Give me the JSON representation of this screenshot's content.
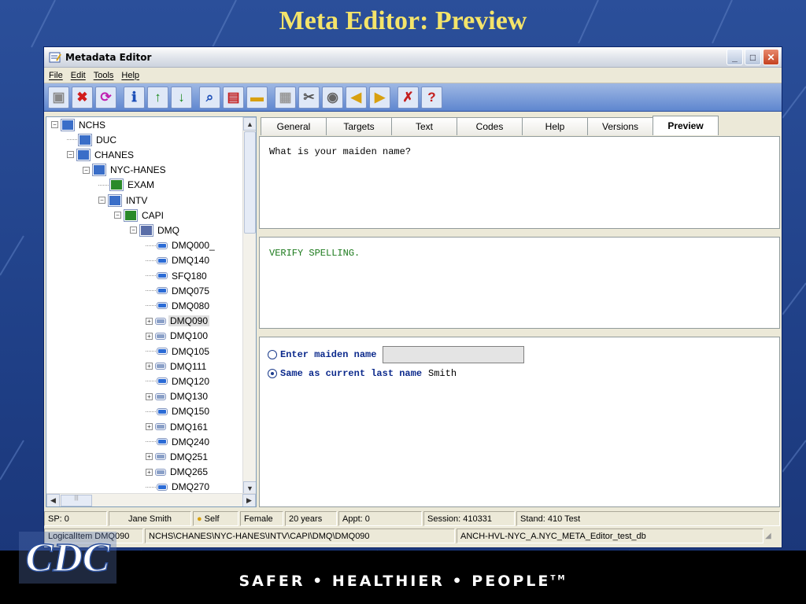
{
  "slide": {
    "title": "Meta Editor: Preview",
    "tagline": "SAFER • HEALTHIER • PEOPLE",
    "tm": "TM",
    "logo_text": "CDC"
  },
  "window": {
    "title": "Metadata Editor",
    "menu": [
      "File",
      "Edit",
      "Tools",
      "Help"
    ]
  },
  "toolbar": {
    "buttons": [
      {
        "name": "save-icon",
        "glyph": "▣",
        "color": "#8a8a8a"
      },
      {
        "name": "delete-icon",
        "glyph": "✖",
        "color": "#d11c1c"
      },
      {
        "name": "refresh-icon",
        "glyph": "⟳",
        "color": "#c020b0"
      },
      {
        "name": "info-icon",
        "glyph": "ℹ",
        "color": "#1d4fb8"
      },
      {
        "name": "move-up-icon",
        "glyph": "↑",
        "color": "#1b8a1b"
      },
      {
        "name": "move-down-icon",
        "glyph": "↓",
        "color": "#1b8a1b"
      },
      {
        "name": "search-icon",
        "glyph": "⌕",
        "color": "#1d4fb8"
      },
      {
        "name": "us-flag-icon",
        "glyph": "▤",
        "color": "#c41e1e"
      },
      {
        "name": "spain-flag-icon",
        "glyph": "▬",
        "color": "#d8a010"
      },
      {
        "name": "document-icon",
        "glyph": "▦",
        "color": "#9a9a9a"
      },
      {
        "name": "tools-icon",
        "glyph": "✂",
        "color": "#555555"
      },
      {
        "name": "audio-icon",
        "glyph": "◉",
        "color": "#666666"
      },
      {
        "name": "previous-icon",
        "glyph": "◀",
        "color": "#d8a010"
      },
      {
        "name": "next-icon",
        "glyph": "▶",
        "color": "#d8a010"
      },
      {
        "name": "clear-icon",
        "glyph": "✗",
        "color": "#c41e1e"
      },
      {
        "name": "help-icon",
        "glyph": "?",
        "color": "#c41e1e"
      }
    ]
  },
  "tree": {
    "nodes": [
      {
        "label": "NCHS",
        "icon": "group",
        "exp": "−"
      },
      {
        "label": "DUC",
        "icon": "group",
        "exp": ""
      },
      {
        "label": "CHANES",
        "icon": "group",
        "exp": "−"
      },
      {
        "label": "NYC-HANES",
        "icon": "group",
        "exp": "−"
      },
      {
        "label": "EXAM",
        "icon": "form",
        "exp": ""
      },
      {
        "label": "INTV",
        "icon": "group",
        "exp": "−"
      },
      {
        "label": "CAPI",
        "icon": "form",
        "exp": "−"
      },
      {
        "label": "DMQ",
        "icon": "section",
        "exp": "−"
      },
      {
        "label": "DMQ000_",
        "icon": "item-special",
        "exp": ""
      },
      {
        "label": "DMQ140",
        "icon": "item",
        "exp": ""
      },
      {
        "label": "SFQ180",
        "icon": "item",
        "exp": ""
      },
      {
        "label": "DMQ075",
        "icon": "item-check",
        "exp": ""
      },
      {
        "label": "DMQ080",
        "icon": "item",
        "exp": ""
      },
      {
        "label": "DMQ090",
        "icon": "item-group",
        "exp": "+"
      },
      {
        "label": "DMQ100",
        "icon": "item-group",
        "exp": "+"
      },
      {
        "label": "DMQ105",
        "icon": "item",
        "exp": ""
      },
      {
        "label": "DMQ111",
        "icon": "item-group",
        "exp": "+"
      },
      {
        "label": "DMQ120",
        "icon": "item-check",
        "exp": ""
      },
      {
        "label": "DMQ130",
        "icon": "item-group",
        "exp": "+"
      },
      {
        "label": "DMQ150",
        "icon": "item-check",
        "exp": ""
      },
      {
        "label": "DMQ161",
        "icon": "item-group",
        "exp": "+"
      },
      {
        "label": "DMQ240",
        "icon": "item",
        "exp": ""
      },
      {
        "label": "DMQ251",
        "icon": "item-group",
        "exp": "+"
      },
      {
        "label": "DMQ265",
        "icon": "item-group",
        "exp": "+"
      },
      {
        "label": "DMQ270",
        "icon": "item-check",
        "exp": ""
      }
    ],
    "selected": "DMQ090"
  },
  "tabs": [
    "General",
    "Targets",
    "Text",
    "Codes",
    "Help",
    "Versions",
    "Preview"
  ],
  "active_tab": "Preview",
  "preview": {
    "question": "What is your maiden name?",
    "instruction": "VERIFY SPELLING.",
    "option1": "Enter maiden name",
    "option1_value": "",
    "option2": "Same as current last name",
    "option2_value": "Smith",
    "selected_option": 2
  },
  "status1": {
    "sp": "SP: 0",
    "name": "Jane Smith",
    "relation": "Self",
    "gender": "Female",
    "age": "20 years",
    "appt": "Appt: 0",
    "session": "Session: 410331",
    "stand": "Stand: 410 Test"
  },
  "status2": {
    "item": "LogicalItem DMQ090",
    "path": "NCHS\\CHANES\\NYC-HANES\\INTV\\CAPI\\DMQ\\DMQ090",
    "db": "ANCH-HVL-NYC_A.NYC_META_Editor_test_db"
  }
}
